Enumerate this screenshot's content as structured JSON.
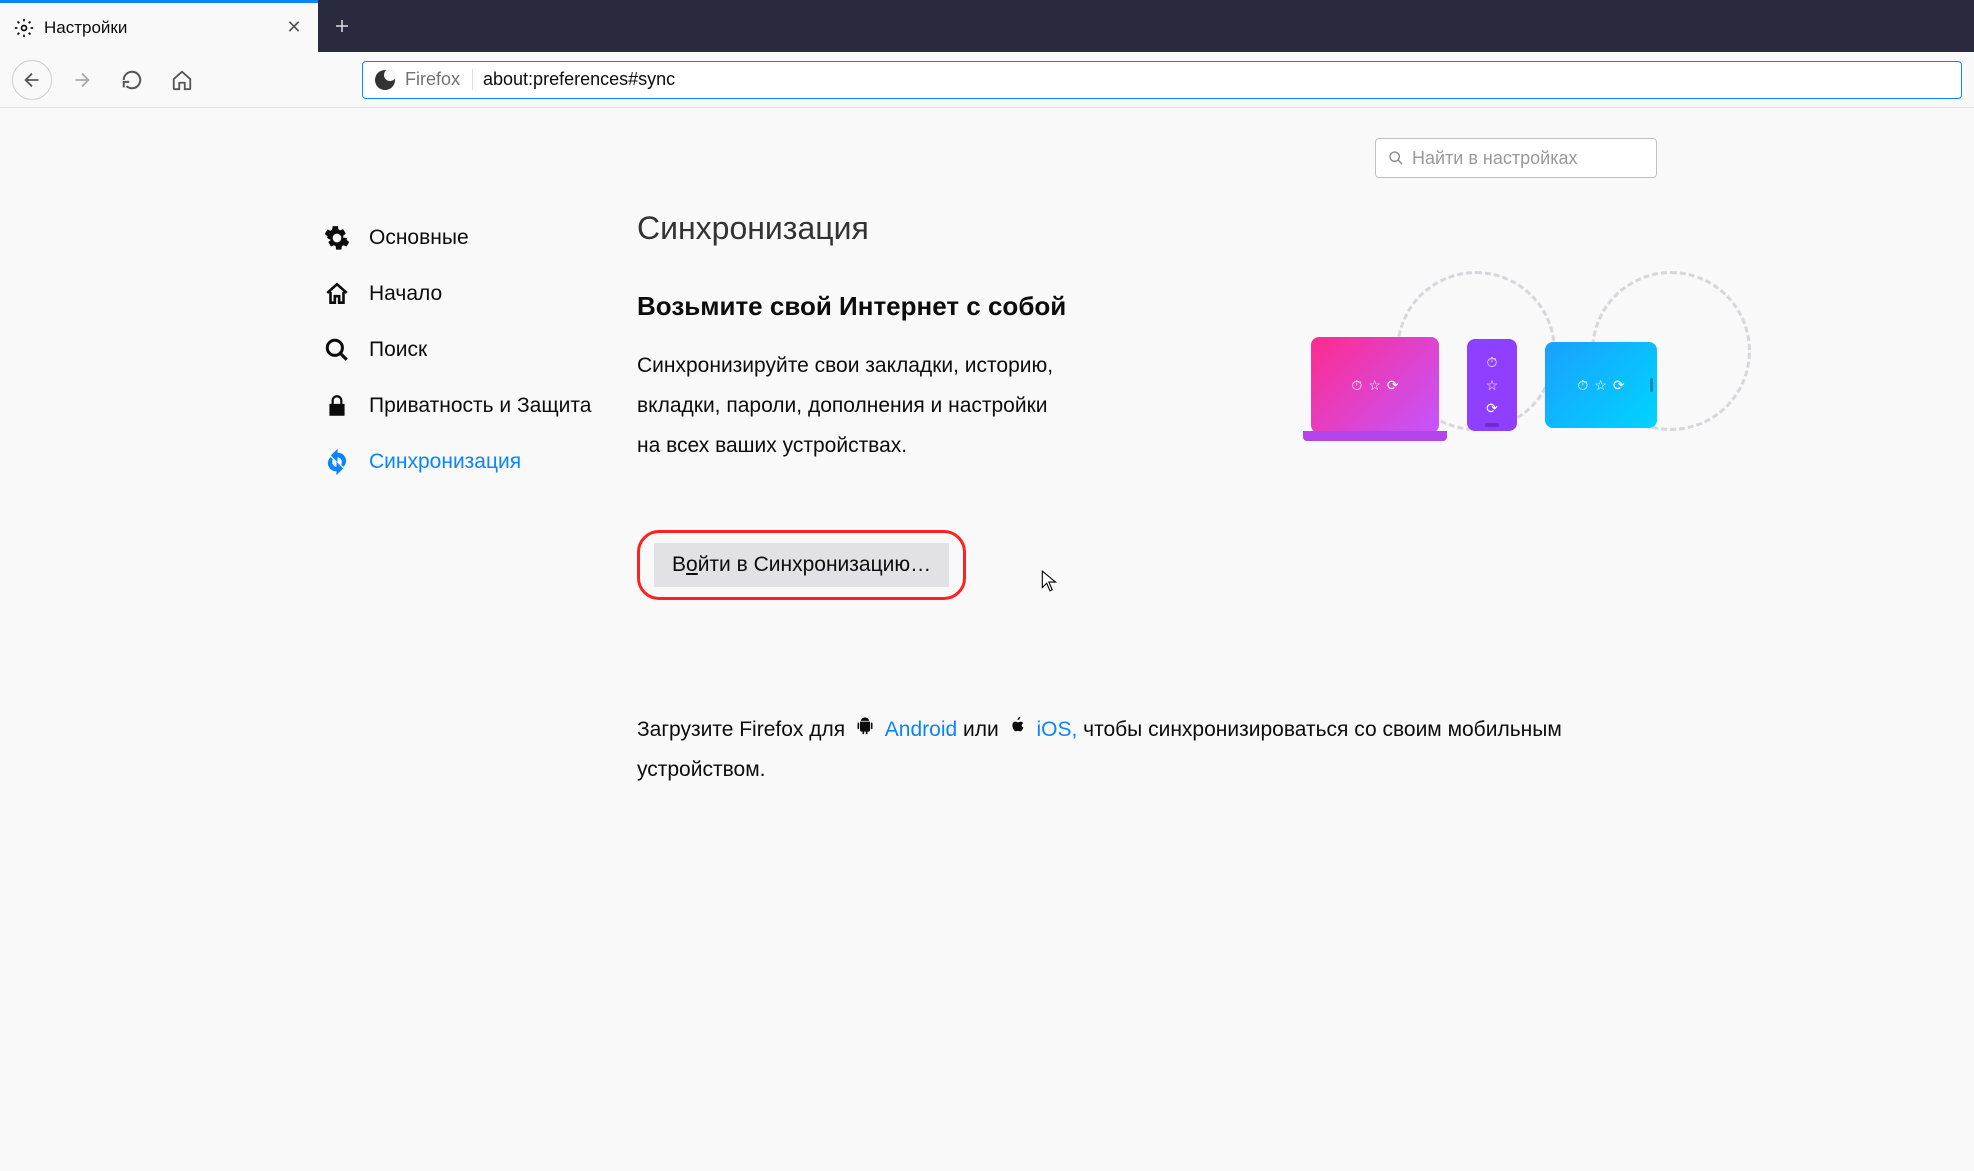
{
  "tab": {
    "title": "Настройки"
  },
  "urlbar": {
    "identity": "Firefox",
    "url": "about:preferences#sync"
  },
  "search": {
    "placeholder": "Найти в настройках"
  },
  "sidebar": {
    "items": [
      {
        "label": "Основные"
      },
      {
        "label": "Начало"
      },
      {
        "label": "Поиск"
      },
      {
        "label": "Приватность и Защита"
      },
      {
        "label": "Синхронизация"
      }
    ]
  },
  "sync": {
    "heading": "Синхронизация",
    "subheading": "Возьмите свой Интернет с собой",
    "description": "Синхронизируйте свои закладки, историю, вкладки, пароли, дополнения и настройки на всех ваших устройствах.",
    "signin_prefix": "В",
    "signin_underline": "о",
    "signin_suffix": "йти в Синхронизацию…",
    "download_prefix": "Загрузите Firefox для ",
    "android": "Android",
    "or": " или ",
    "ios": "iOS,",
    "download_suffix": " чтобы синхронизироваться со своим мобильным устройством."
  }
}
